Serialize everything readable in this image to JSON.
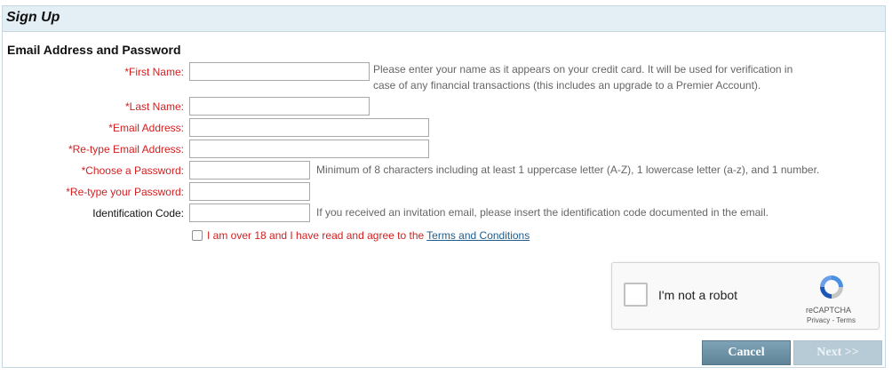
{
  "header": {
    "title": "Sign Up"
  },
  "section": {
    "title": "Email Address and Password"
  },
  "fields": {
    "first_name": {
      "label": "*First Name:",
      "value": "",
      "hint_line1": "Please enter your name as it appears on your credit card. It will be used for verification in",
      "hint_line2": "case of any financial transactions (this includes an upgrade to a Premier Account)."
    },
    "last_name": {
      "label": "*Last Name:",
      "value": ""
    },
    "email": {
      "label": "*Email Address:",
      "value": ""
    },
    "email_confirm": {
      "label": "*Re-type Email Address:",
      "value": ""
    },
    "password": {
      "label": "*Choose a Password:",
      "value": "",
      "hint": "Minimum of 8 characters including at least 1 uppercase letter (A-Z), 1 lowercase letter (a-z), and 1 number."
    },
    "password_confirm": {
      "label": "*Re-type your Password:",
      "value": ""
    },
    "id_code": {
      "label": "Identification Code:",
      "value": "",
      "hint": "If you received an invitation email, please insert the identification code documented in the email."
    }
  },
  "terms": {
    "text": "I am over 18 and I have read and agree to the ",
    "link": "Terms and Conditions",
    "checked": false
  },
  "captcha": {
    "label": "I'm not a robot",
    "brand": "reCAPTCHA",
    "links": "Privacy - Terms"
  },
  "buttons": {
    "cancel": "Cancel",
    "next": "Next >>"
  },
  "colors": {
    "required_label": "#d21f1f",
    "header_bg": "#e4eef5",
    "link": "#1f5d8c",
    "cancel_btn": "#6f93a7",
    "next_btn_disabled": "#b7cbd6"
  }
}
